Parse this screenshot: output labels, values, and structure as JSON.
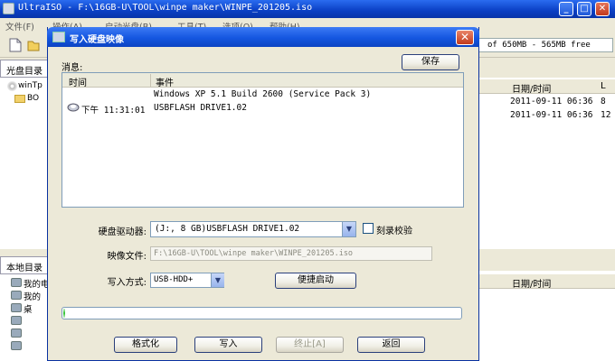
{
  "app": {
    "title": "UltraISO - F:\\16GB-U\\TOOL\\winpe maker\\WINPE_201205.iso",
    "menu": [
      "文件(F)",
      "操作(A)",
      "启动光盘(B)",
      "工具(T)",
      "选项(O)",
      "帮助(H)"
    ],
    "capacity": "of 650MB - 565MB free",
    "panel_disc_label": "光盘目录",
    "panel_local_label": "本地目录",
    "tree_top": [
      "winTp",
      "BO"
    ],
    "tree_bottom": [
      "我的电",
      "我的",
      "桌",
      "",
      ""
    ],
    "list_headers": [
      "日期/时间",
      "L"
    ],
    "list_rows": [
      {
        "date": "2011-09-11 06:36",
        "l": "8"
      },
      {
        "date": "2011-09-11 06:36",
        "l": "12"
      }
    ],
    "list2_headers": [
      "日期/时间"
    ]
  },
  "dialog": {
    "title": "写入硬盘映像",
    "close": "✕",
    "message_label": "消息:",
    "save_label": "保存",
    "log_headers": {
      "time": "时间",
      "event": "事件"
    },
    "log_rows": [
      {
        "time": "",
        "event": "Windows XP 5.1 Build 2600 (Service Pack 3)"
      },
      {
        "time": "下午 11:31:01",
        "event": "USBFLASH DRIVE1.02"
      }
    ],
    "drive_label": "硬盘驱动器:",
    "drive_value": "(J:, 8 GB)USBFLASH DRIVE1.02",
    "verify_label": "刻录校验",
    "verify_checked": false,
    "image_label": "映像文件:",
    "image_value": "F:\\16GB-U\\TOOL\\winpe maker\\WINPE_201205.iso",
    "mode_label": "写入方式:",
    "mode_value": "USB-HDD+",
    "boot_label": "便捷启动",
    "progress_fraction": 0.0,
    "buttons": {
      "format": "格式化",
      "write": "写入",
      "abort": "终止[A]",
      "back": "返回"
    }
  }
}
